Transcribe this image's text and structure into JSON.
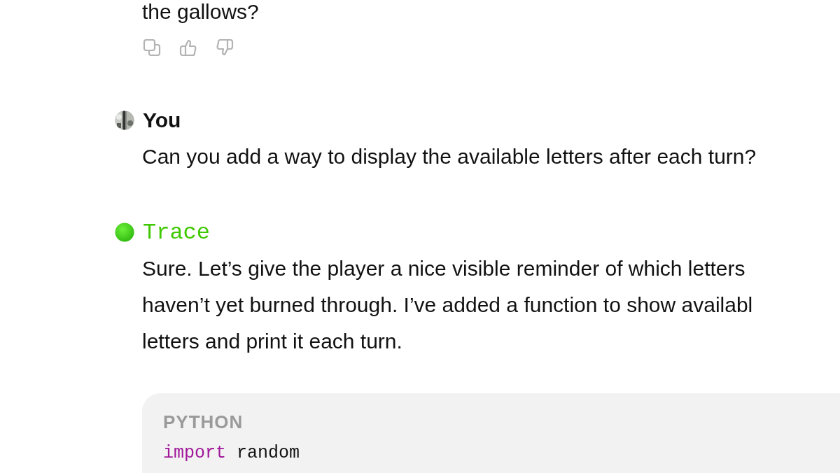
{
  "previous_message": {
    "text_tail": "the gallows?"
  },
  "messages": [
    {
      "author": "You",
      "kind": "user",
      "lines": [
        "Can you add a way to display the available letters after each turn?"
      ]
    },
    {
      "author": "Trace",
      "kind": "assistant",
      "lines": [
        "Sure. Let’s give the player a nice visible reminder of which letters",
        "haven’t yet burned through. I’ve added a function to show availabl",
        "letters and print it each turn."
      ],
      "code_block": {
        "language": "PYTHON",
        "lines": [
          [
            {
              "text": "import",
              "kind": "keyword"
            },
            {
              "text": "random",
              "kind": "plain"
            }
          ]
        ]
      }
    }
  ]
}
